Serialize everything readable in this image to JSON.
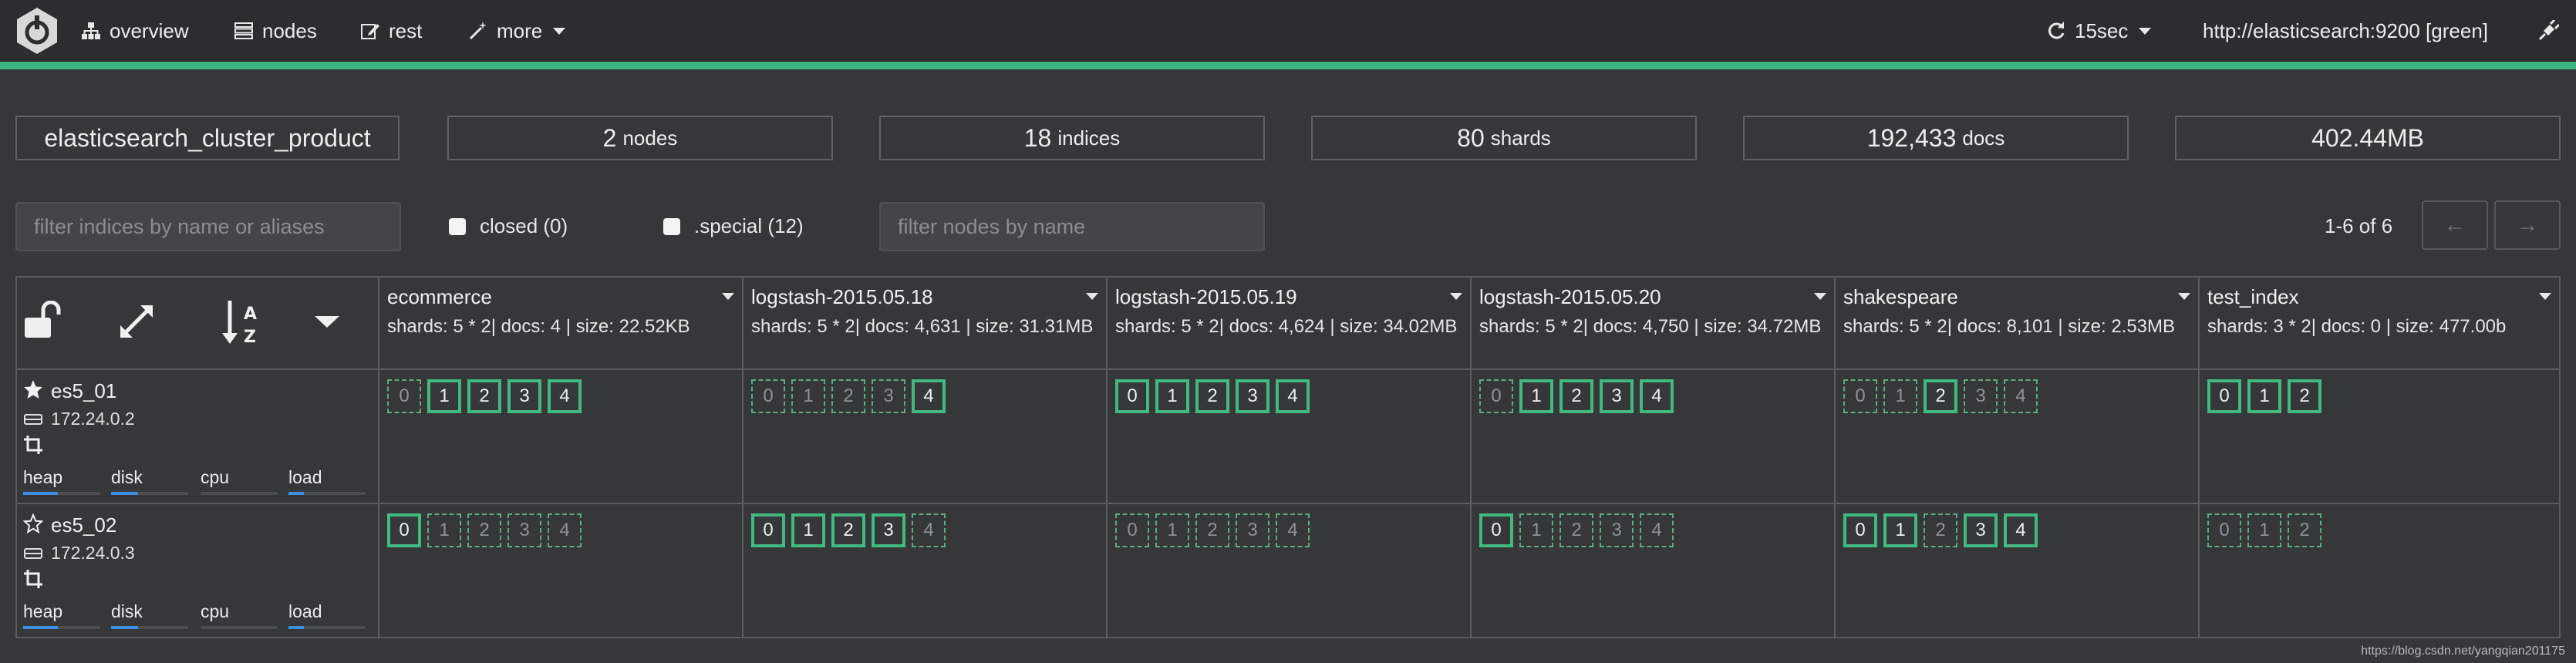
{
  "nav": {
    "overview": "overview",
    "nodes": "nodes",
    "rest": "rest",
    "more": "more",
    "refresh": "15sec",
    "host": "http://elasticsearch:9200 [green]"
  },
  "stats": {
    "cluster_name": "elasticsearch_cluster_product",
    "nodes_count": "2",
    "nodes_label": "nodes",
    "indices_count": "18",
    "indices_label": "indices",
    "shards_count": "80",
    "shards_label": "shards",
    "docs_count": "192,433",
    "docs_label": "docs",
    "size": "402.44MB"
  },
  "filters": {
    "indices_placeholder": "filter indices by name or aliases",
    "closed_label": "closed (0)",
    "special_label": ".special (12)",
    "nodes_placeholder": "filter nodes by name",
    "page_info": "1-6 of 6",
    "prev": "←",
    "next": "→"
  },
  "indices": [
    {
      "name": "ecommerce",
      "info": "shards: 5 * 2| docs: 4 | size: 22.52KB"
    },
    {
      "name": "logstash-2015.05.18",
      "info": "shards: 5 * 2| docs: 4,631 | size: 31.31MB"
    },
    {
      "name": "logstash-2015.05.19",
      "info": "shards: 5 * 2| docs: 4,624 | size: 34.02MB"
    },
    {
      "name": "logstash-2015.05.20",
      "info": "shards: 5 * 2| docs: 4,750 | size: 34.72MB"
    },
    {
      "name": "shakespeare",
      "info": "shards: 5 * 2| docs: 8,101 | size: 2.53MB"
    },
    {
      "name": "test_index",
      "info": "shards: 3 * 2| docs: 0 | size: 477.00b"
    }
  ],
  "nodes": [
    {
      "name": "es5_01",
      "ip": "172.24.0.2",
      "master": true,
      "metrics": {
        "heap": 0.45,
        "disk": 0.35,
        "cpu": 0.0,
        "load": 0.2
      },
      "shards": [
        [
          {
            "n": "0",
            "p": false
          },
          {
            "n": "1",
            "p": true
          },
          {
            "n": "2",
            "p": true
          },
          {
            "n": "3",
            "p": true
          },
          {
            "n": "4",
            "p": true
          }
        ],
        [
          {
            "n": "0",
            "p": false
          },
          {
            "n": "1",
            "p": false
          },
          {
            "n": "2",
            "p": false
          },
          {
            "n": "3",
            "p": false
          },
          {
            "n": "4",
            "p": true
          }
        ],
        [
          {
            "n": "0",
            "p": true
          },
          {
            "n": "1",
            "p": true
          },
          {
            "n": "2",
            "p": true
          },
          {
            "n": "3",
            "p": true
          },
          {
            "n": "4",
            "p": true
          }
        ],
        [
          {
            "n": "0",
            "p": false
          },
          {
            "n": "1",
            "p": true
          },
          {
            "n": "2",
            "p": true
          },
          {
            "n": "3",
            "p": true
          },
          {
            "n": "4",
            "p": true
          }
        ],
        [
          {
            "n": "0",
            "p": false
          },
          {
            "n": "1",
            "p": false
          },
          {
            "n": "2",
            "p": true
          },
          {
            "n": "3",
            "p": false
          },
          {
            "n": "4",
            "p": false
          }
        ],
        [
          {
            "n": "0",
            "p": true
          },
          {
            "n": "1",
            "p": true
          },
          {
            "n": "2",
            "p": true
          }
        ]
      ]
    },
    {
      "name": "es5_02",
      "ip": "172.24.0.3",
      "master": false,
      "metrics": {
        "heap": 0.45,
        "disk": 0.35,
        "cpu": 0.0,
        "load": 0.2
      },
      "shards": [
        [
          {
            "n": "0",
            "p": true
          },
          {
            "n": "1",
            "p": false
          },
          {
            "n": "2",
            "p": false
          },
          {
            "n": "3",
            "p": false
          },
          {
            "n": "4",
            "p": false
          }
        ],
        [
          {
            "n": "0",
            "p": true
          },
          {
            "n": "1",
            "p": true
          },
          {
            "n": "2",
            "p": true
          },
          {
            "n": "3",
            "p": true
          },
          {
            "n": "4",
            "p": false
          }
        ],
        [
          {
            "n": "0",
            "p": false
          },
          {
            "n": "1",
            "p": false
          },
          {
            "n": "2",
            "p": false
          },
          {
            "n": "3",
            "p": false
          },
          {
            "n": "4",
            "p": false
          }
        ],
        [
          {
            "n": "0",
            "p": true
          },
          {
            "n": "1",
            "p": false
          },
          {
            "n": "2",
            "p": false
          },
          {
            "n": "3",
            "p": false
          },
          {
            "n": "4",
            "p": false
          }
        ],
        [
          {
            "n": "0",
            "p": true
          },
          {
            "n": "1",
            "p": true
          },
          {
            "n": "2",
            "p": false
          },
          {
            "n": "3",
            "p": true
          },
          {
            "n": "4",
            "p": true
          }
        ],
        [
          {
            "n": "0",
            "p": false
          },
          {
            "n": "1",
            "p": false
          },
          {
            "n": "2",
            "p": false
          }
        ]
      ]
    }
  ],
  "metric_labels": {
    "heap": "heap",
    "disk": "disk",
    "cpu": "cpu",
    "load": "load"
  },
  "colors": {
    "accent": "#3eb580",
    "shard_border": "#42b883",
    "metric_bar": "#3d8ee0"
  },
  "watermark": "https://blog.csdn.net/yangqian201175"
}
